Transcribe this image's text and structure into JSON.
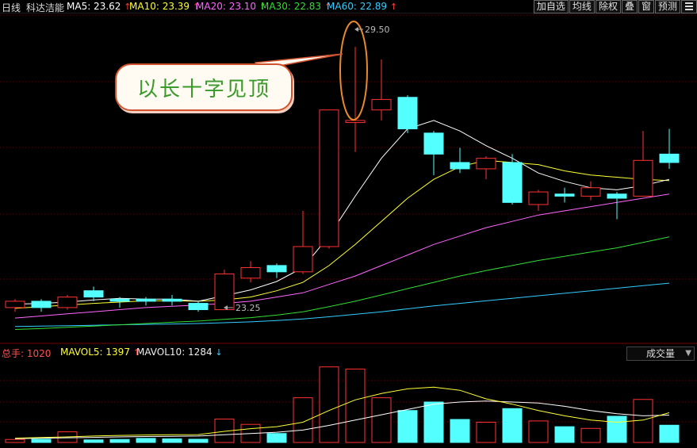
{
  "header": {
    "period": "日线",
    "stock_name": "科达洁能",
    "ma5": "MA5: 23.62",
    "ma10": "MA10: 23.39",
    "ma20": "MA20: 23.10",
    "ma30": "MA30: 22.83",
    "ma60": "MA60: 22.89",
    "ma5_color": "#ffffff",
    "ma10_color": "#ffff33",
    "ma20_color": "#ff66ff",
    "ma30_color": "#33dd33",
    "ma60_color": "#33ccff"
  },
  "toolbar": {
    "add_watch": "加自选",
    "ma_line": "均线",
    "ex_rights": "除权",
    "overlay": "叠",
    "window": "窗",
    "forecast": "预测",
    "menu_icon": "menu-icon"
  },
  "annotation": {
    "text": "以长十字见顶"
  },
  "price_labels": {
    "high": "29.50",
    "low": "23.25"
  },
  "volume_header": {
    "total_hands": "总手: 1020",
    "mavol5": "MAVOL5: 1397",
    "mavol10": "MAVOL10: 1284",
    "selector": "成交量"
  },
  "chart_data": {
    "type": "candlestick",
    "ylim": [
      22.6,
      30.2
    ],
    "candles": [
      {
        "o": 23.3,
        "c": 23.45,
        "h": 23.5,
        "l": 23.2,
        "up": true
      },
      {
        "o": 23.45,
        "c": 23.3,
        "h": 23.5,
        "l": 23.2,
        "up": false
      },
      {
        "o": 23.3,
        "c": 23.55,
        "h": 23.6,
        "l": 23.25,
        "up": true
      },
      {
        "o": 23.7,
        "c": 23.55,
        "h": 23.8,
        "l": 23.45,
        "up": false
      },
      {
        "o": 23.5,
        "c": 23.45,
        "h": 23.55,
        "l": 23.3,
        "up": false
      },
      {
        "o": 23.5,
        "c": 23.45,
        "h": 23.55,
        "l": 23.35,
        "up": false
      },
      {
        "o": 23.5,
        "c": 23.45,
        "h": 23.6,
        "l": 23.35,
        "up": false
      },
      {
        "o": 23.4,
        "c": 23.25,
        "h": 23.45,
        "l": 23.2,
        "up": false
      },
      {
        "o": 23.25,
        "c": 24.1,
        "h": 24.2,
        "l": 23.25,
        "up": true
      },
      {
        "o": 24.0,
        "c": 24.25,
        "h": 24.4,
        "l": 23.9,
        "up": true
      },
      {
        "o": 24.3,
        "c": 24.15,
        "h": 24.35,
        "l": 24.0,
        "up": false
      },
      {
        "o": 24.15,
        "c": 24.75,
        "h": 25.6,
        "l": 24.1,
        "up": true
      },
      {
        "o": 24.75,
        "c": 28.0,
        "h": 28.0,
        "l": 24.7,
        "up": true
      },
      {
        "o": 27.7,
        "c": 27.75,
        "h": 29.5,
        "l": 27.0,
        "up": true
      },
      {
        "o": 28.0,
        "c": 28.25,
        "h": 29.2,
        "l": 27.75,
        "up": true
      },
      {
        "o": 28.3,
        "c": 27.55,
        "h": 28.35,
        "l": 27.45,
        "up": false
      },
      {
        "o": 27.45,
        "c": 26.95,
        "h": 27.5,
        "l": 26.45,
        "up": false
      },
      {
        "o": 26.75,
        "c": 26.6,
        "h": 27.1,
        "l": 26.5,
        "up": false
      },
      {
        "o": 26.6,
        "c": 26.85,
        "h": 26.9,
        "l": 26.35,
        "up": true
      },
      {
        "o": 26.75,
        "c": 25.8,
        "h": 26.95,
        "l": 25.75,
        "up": false
      },
      {
        "o": 25.75,
        "c": 26.05,
        "h": 26.1,
        "l": 25.6,
        "up": true
      },
      {
        "o": 26.0,
        "c": 25.95,
        "h": 26.15,
        "l": 25.8,
        "up": false
      },
      {
        "o": 25.95,
        "c": 26.15,
        "h": 26.3,
        "l": 25.85,
        "up": true
      },
      {
        "o": 26.0,
        "c": 25.9,
        "h": 26.05,
        "l": 25.4,
        "up": false
      },
      {
        "o": 25.95,
        "c": 26.8,
        "h": 27.5,
        "l": 25.95,
        "up": true
      },
      {
        "o": 26.95,
        "c": 26.75,
        "h": 27.55,
        "l": 26.6,
        "up": false
      }
    ],
    "ma5": [
      23.38,
      23.4,
      23.43,
      23.48,
      23.52,
      23.5,
      23.5,
      23.45,
      23.58,
      23.72,
      23.92,
      24.25,
      25.0,
      25.95,
      26.85,
      27.55,
      27.75,
      27.5,
      27.15,
      26.85,
      26.5,
      26.3,
      26.15,
      26.1,
      26.2,
      26.35
    ],
    "ma10": [
      23.28,
      23.32,
      23.36,
      23.4,
      23.43,
      23.46,
      23.46,
      23.45,
      23.48,
      23.55,
      23.7,
      23.9,
      24.3,
      24.8,
      25.35,
      25.9,
      26.35,
      26.65,
      26.8,
      26.75,
      26.7,
      26.55,
      26.45,
      26.4,
      26.35,
      26.32
    ],
    "ma20": [
      23.05,
      23.1,
      23.15,
      23.2,
      23.25,
      23.3,
      23.33,
      23.36,
      23.4,
      23.45,
      23.55,
      23.65,
      23.85,
      24.05,
      24.3,
      24.55,
      24.8,
      25.0,
      25.2,
      25.35,
      25.5,
      25.6,
      25.7,
      25.8,
      25.9,
      26.0
    ],
    "ma30": [
      22.78,
      22.8,
      22.83,
      22.86,
      22.89,
      22.92,
      22.95,
      22.98,
      23.02,
      23.06,
      23.12,
      23.2,
      23.32,
      23.45,
      23.6,
      23.75,
      23.9,
      24.05,
      24.18,
      24.3,
      24.42,
      24.52,
      24.62,
      24.72,
      24.85,
      24.98
    ],
    "ma60": [
      22.85,
      22.86,
      22.87,
      22.88,
      22.89,
      22.9,
      22.91,
      22.92,
      22.94,
      22.96,
      22.99,
      23.03,
      23.08,
      23.14,
      23.2,
      23.27,
      23.34,
      23.4,
      23.46,
      23.52,
      23.58,
      23.64,
      23.7,
      23.76,
      23.82,
      23.88
    ],
    "volume": [
      140,
      150,
      500,
      120,
      140,
      190,
      170,
      150,
      1100,
      850,
      420,
      2100,
      3550,
      3450,
      2100,
      1500,
      1900,
      1080,
      950,
      1590,
      1010,
      740,
      660,
      1230,
      2020,
      810
    ],
    "vol_ylim": [
      0,
      3800
    ],
    "mavol5": [
      200,
      230,
      260,
      300,
      330,
      350,
      360,
      370,
      520,
      650,
      740,
      950,
      1500,
      2000,
      2300,
      2520,
      2600,
      2450,
      2050,
      1800,
      1500,
      1250,
      1050,
      950,
      1050,
      1397
    ],
    "mavol10": [
      180,
      200,
      220,
      240,
      260,
      280,
      290,
      300,
      360,
      420,
      480,
      580,
      800,
      1050,
      1300,
      1550,
      1800,
      1900,
      1950,
      1900,
      1850,
      1700,
      1500,
      1350,
      1250,
      1284
    ]
  }
}
